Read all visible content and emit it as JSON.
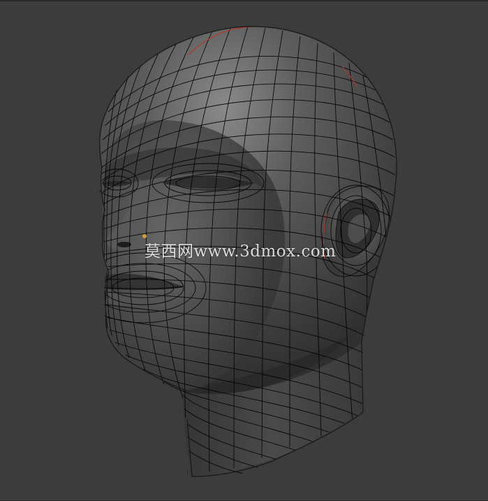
{
  "viewport": {
    "background": "#3c3c3c",
    "mesh_color": "#000000",
    "surface_color": "#5c5c5c",
    "seam_color": "#b13a2a",
    "vertex_highlight_color": "#d79a3a"
  },
  "model": {
    "object": "head-mesh",
    "shading": "matcap-gray",
    "wireframe_overlay": true
  },
  "watermark": {
    "text": "莫西网www.3dmox.com"
  }
}
